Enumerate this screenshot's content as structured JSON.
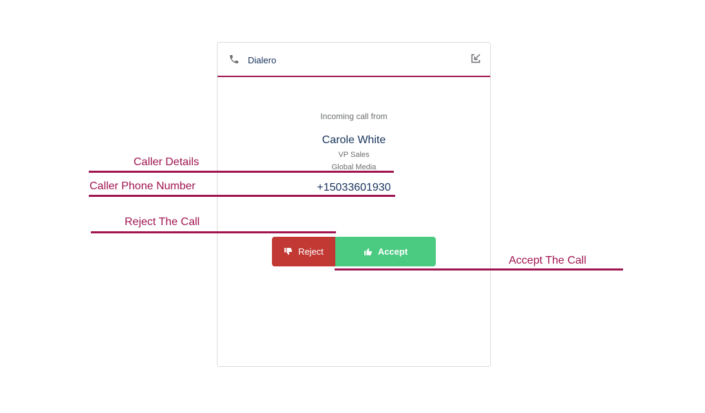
{
  "widget": {
    "title": "Dialero",
    "phone_icon": "phone-icon",
    "popout_icon": "popout-icon"
  },
  "call": {
    "incoming_label": "Incoming call from",
    "caller_name": "Carole White",
    "caller_title": "VP Sales",
    "caller_company": "Global Media",
    "caller_phone": "+15033601930"
  },
  "actions": {
    "reject_label": "Reject",
    "reject_icon": "thumbs-down-icon",
    "accept_label": "Accept",
    "accept_icon": "thumbs-up-icon"
  },
  "annotations": {
    "caller_details": "Caller Details",
    "caller_phone_number": "Caller Phone Number",
    "reject_the_call": "Reject The Call",
    "accept_the_call": "Accept The Call"
  },
  "colors": {
    "accent": "#a0144f",
    "reject": "#c23934",
    "accept": "#4bca81",
    "text_primary": "#16325c",
    "text_secondary": "#6b6d70"
  }
}
